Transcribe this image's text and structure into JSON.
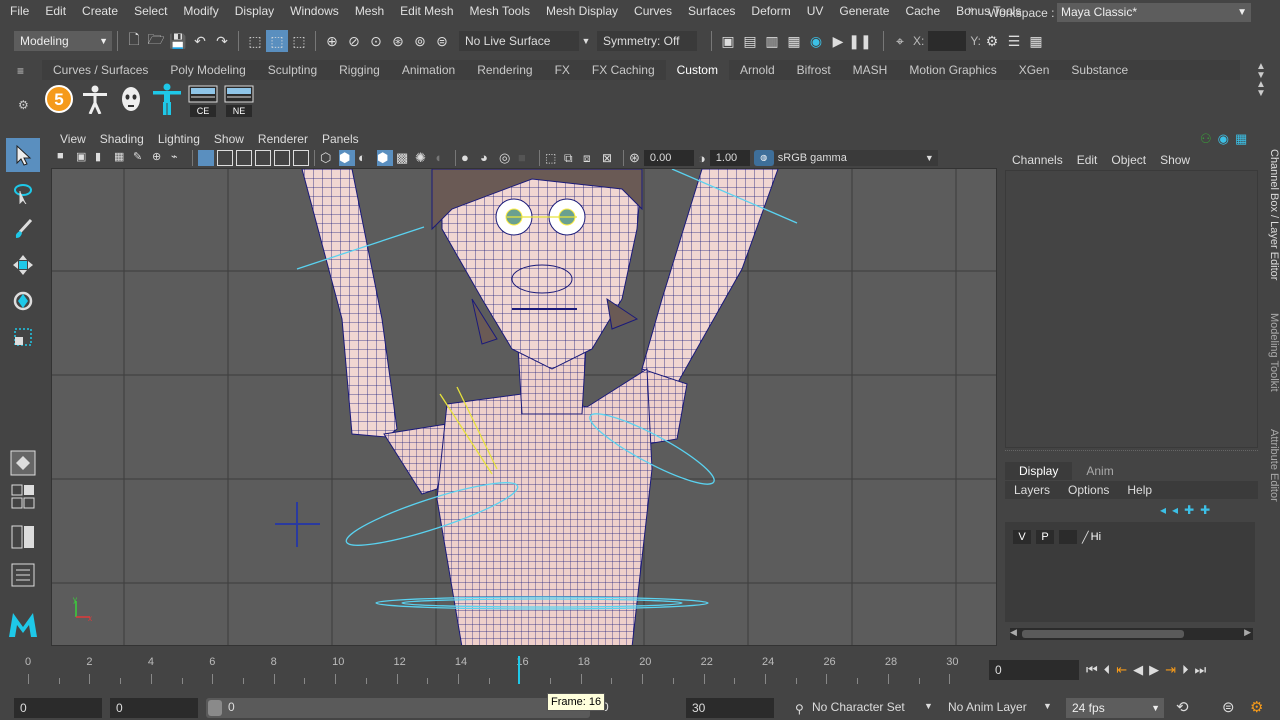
{
  "menubar": {
    "items": [
      "File",
      "Edit",
      "Create",
      "Select",
      "Modify",
      "Display",
      "Windows",
      "Mesh",
      "Edit Mesh",
      "Mesh Tools",
      "Mesh Display",
      "Curves",
      "Surfaces",
      "Deform",
      "UV",
      "Generate",
      "Cache",
      "Bonus Tools"
    ],
    "workspace_label": "Workspace :",
    "workspace_value": "Maya Classic*"
  },
  "statusline": {
    "menuset": "Modeling",
    "live_surface": "No Live Surface",
    "symmetry": "Symmetry: Off",
    "x_label": "X:",
    "y_label": "Y:"
  },
  "shelf": {
    "tabs": [
      "Curves / Surfaces",
      "Poly Modeling",
      "Sculpting",
      "Rigging",
      "Animation",
      "Rendering",
      "FX",
      "FX Caching",
      "Custom",
      "Arnold",
      "Bifrost",
      "MASH",
      "Motion Graphics",
      "XGen",
      "Substance"
    ],
    "active_tab": "Custom",
    "icons": [
      {
        "name": "five-icon",
        "label": "5"
      },
      {
        "name": "skeleton-icon",
        "label": ""
      },
      {
        "name": "mask-icon",
        "label": ""
      },
      {
        "name": "tpose-icon",
        "label": ""
      },
      {
        "name": "ce-icon",
        "label": "CE"
      },
      {
        "name": "ne-icon",
        "label": "NE"
      }
    ]
  },
  "viewport": {
    "menus": [
      "View",
      "Shading",
      "Lighting",
      "Show",
      "Renderer",
      "Panels"
    ],
    "near_value": "0.00",
    "far_value": "1.00",
    "color_space": "sRGB gamma",
    "axis_x": "x",
    "axis_y": "y"
  },
  "channelbox": {
    "menus": [
      "Channels",
      "Edit",
      "Object",
      "Show"
    ]
  },
  "layers": {
    "tabs": [
      "Display",
      "Anim"
    ],
    "menus": [
      "Layers",
      "Options",
      "Help"
    ],
    "row": {
      "v": "V",
      "p": "P",
      "name": "Hi"
    }
  },
  "side_tabs": [
    "Channel Box / Layer Editor",
    "Modeling Toolkit",
    "Attribute Editor"
  ],
  "timeslider": {
    "ticks": [
      "0",
      "2",
      "4",
      "6",
      "8",
      "10",
      "12",
      "14",
      "16",
      "18",
      "20",
      "22",
      "24",
      "26",
      "28",
      "30"
    ],
    "start_label": "0",
    "current_frame_field": "0",
    "current_frame": 16
  },
  "range": {
    "start": "0",
    "anim_start": "0",
    "playback_start": "0",
    "playback_end": "0",
    "anim_end": "30",
    "character_set": "No Character Set",
    "anim_layer": "No Anim Layer",
    "fps": "24 fps",
    "tooltip": "Frame: 16"
  },
  "colors": {
    "accent_cyan": "#1ec8e8",
    "orange": "#f59a1a",
    "wire": "#1a1a7a",
    "skin": "#f1d6d2"
  }
}
